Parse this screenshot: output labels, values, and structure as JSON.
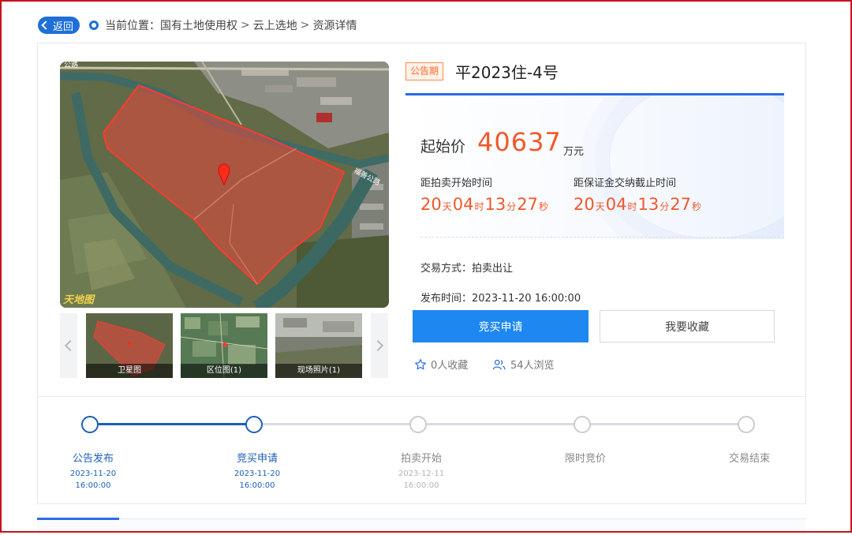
{
  "nav": {
    "back_label": "返回",
    "location_label": "当前位置：",
    "breadcrumb": [
      "国有土地使用权",
      "云上选地",
      "资源详情"
    ],
    "separator": ">"
  },
  "map": {
    "logo_text": "天地图",
    "road_labels": [
      "福善公路",
      "公路"
    ]
  },
  "thumbnails": [
    {
      "label": "卫星图"
    },
    {
      "label": "区位图(1)"
    },
    {
      "label": "现场照片(1)"
    }
  ],
  "land": {
    "status": "公告期",
    "title": "平2023住-4号",
    "price_label": "起始价",
    "price_value": "40637",
    "price_unit": "万元"
  },
  "countdowns": [
    {
      "title": "距拍卖开始时间",
      "days": "20",
      "hours": "04",
      "minutes": "13",
      "seconds": "27"
    },
    {
      "title": "距保证金交纳截止时间",
      "days": "20",
      "hours": "04",
      "minutes": "13",
      "seconds": "27"
    }
  ],
  "units": {
    "day": "天",
    "hour": "时",
    "minute": "分",
    "second": "秒"
  },
  "details": {
    "trade_method_label": "交易方式：",
    "trade_method": "拍卖出让",
    "publish_time_label": "发布时间：",
    "publish_time": "2023-11-20 16:00:00"
  },
  "actions": {
    "bid_label": "竞买申请",
    "favorite_label": "我要收藏"
  },
  "stats": {
    "favorites": "0人收藏",
    "views": "54人浏览"
  },
  "timeline": [
    {
      "name": "公告发布",
      "date": "2023-11-20",
      "time": "16:00:00",
      "status": "done"
    },
    {
      "name": "竞买申请",
      "date": "2023-11-20",
      "time": "16:00:00",
      "status": "done"
    },
    {
      "name": "拍卖开始",
      "date": "2023-12-11",
      "time": "16:00:00",
      "status": "todo"
    },
    {
      "name": "限时竞价",
      "date": "",
      "time": "",
      "status": "todo"
    },
    {
      "name": "交易结束",
      "date": "",
      "time": "",
      "status": "todo"
    }
  ],
  "colors": {
    "primary": "#1e88f0",
    "accent_orange": "#f0582b",
    "timeline_done": "#1c5fb7",
    "timeline_todo": "#c9ccd1",
    "parcel_overlay": "#e8453c"
  }
}
